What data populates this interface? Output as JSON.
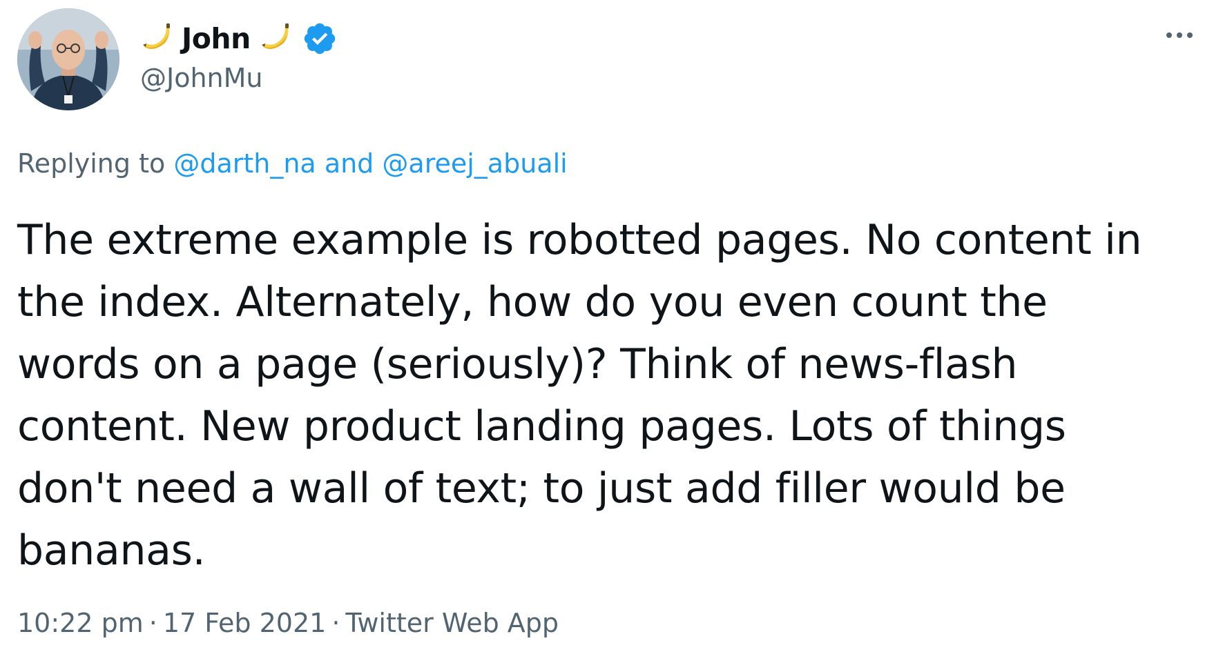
{
  "author": {
    "display_name": "John",
    "handle": "@JohnMu",
    "name_emoji_left": "banana-icon",
    "name_emoji_right": "banana-icon",
    "verified_icon": "verified-badge-icon"
  },
  "more_menu": {
    "icon": "more-horizontal-icon"
  },
  "reply_context": {
    "prefix": "Replying to",
    "mention_1": "@darth_na",
    "joiner": "and",
    "mention_2": "@areej_abuali"
  },
  "tweet": {
    "lines": [
      "The extreme example is robotted pages. No content in",
      "the index. Alternately, how do you even count the",
      "words on a page (seriously)? Think of news-flash",
      "content. New product landing pages. Lots of things",
      "don't need a wall of text; to just add filler would be",
      "bananas."
    ]
  },
  "meta": {
    "time": "10:22 pm",
    "separator": "·",
    "date": "17 Feb 2021",
    "source": "Twitter Web App"
  },
  "colors": {
    "text_primary": "#0f1419",
    "text_secondary": "#536471",
    "accent": "#1d9bf0"
  }
}
